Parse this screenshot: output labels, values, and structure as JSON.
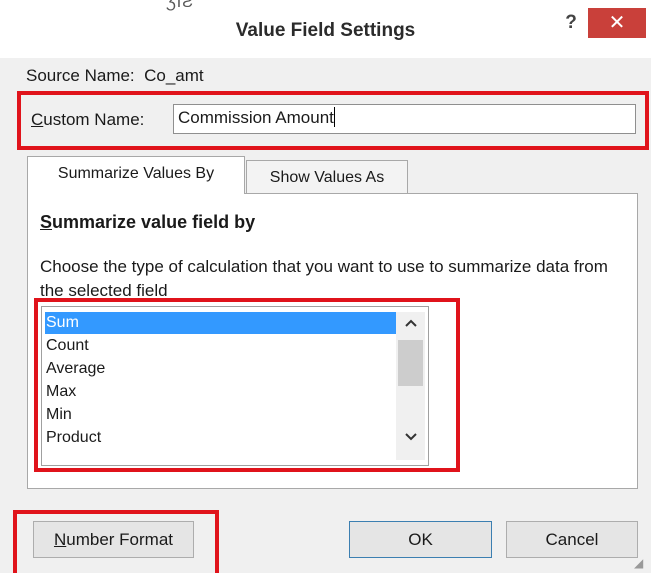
{
  "window": {
    "title": "Value Field Settings",
    "help_symbol": "?",
    "close_symbol": "✕",
    "cutoff_text": "ƷIƧ"
  },
  "source": {
    "label": "Source Name:",
    "value": "Co_amt"
  },
  "custom_name": {
    "label_first": "C",
    "label_rest": "ustom Name:",
    "value": "Commission Amount"
  },
  "tabs": [
    {
      "label": "Summarize Values By",
      "active": true
    },
    {
      "label": "Show Values As",
      "active": false
    }
  ],
  "summarize": {
    "heading_first": "S",
    "heading_rest": "ummarize value field by",
    "description": "Choose the type of calculation that you want to use to summarize data from the selected field",
    "items": [
      "Sum",
      "Count",
      "Average",
      "Max",
      "Min",
      "Product"
    ],
    "selected_index": 0
  },
  "buttons": {
    "number_format_first": "N",
    "number_format_rest": "umber Format",
    "ok": "OK",
    "cancel": "Cancel"
  },
  "icons": {
    "scroll_up": "▲",
    "scroll_down": "▼",
    "help": "help-icon",
    "close": "close-icon"
  },
  "colors": {
    "close_button": "#c9403a",
    "selection": "#3399ff",
    "annotation": "#e0131b"
  }
}
